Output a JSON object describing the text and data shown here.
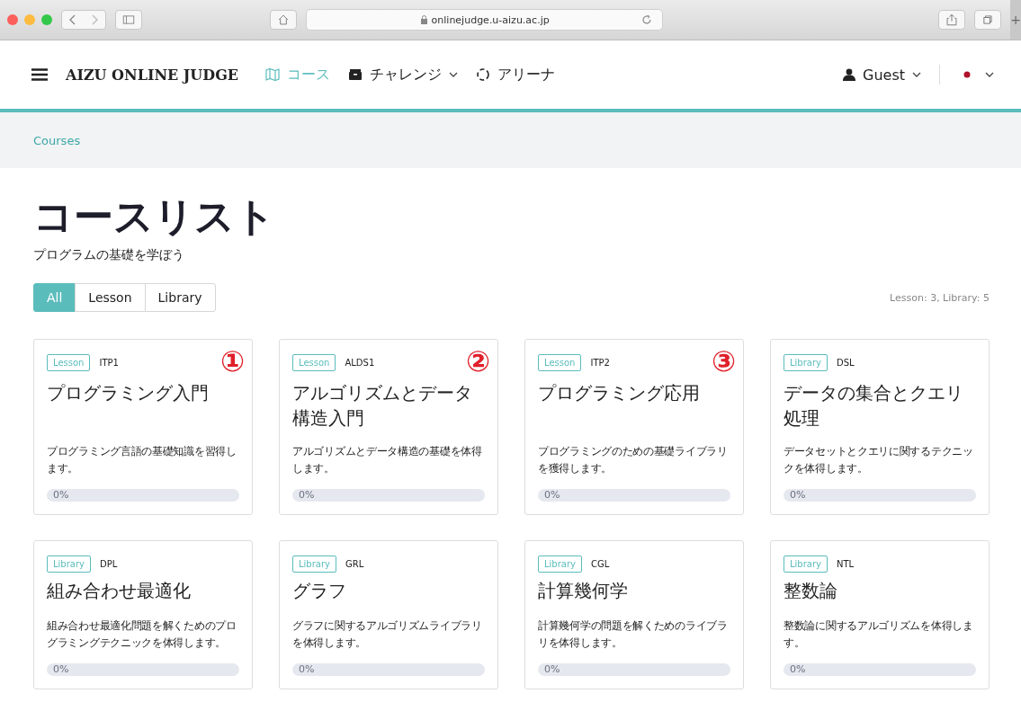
{
  "browser": {
    "url": "onlinejudge.u-aizu.ac.jp",
    "new_tab": "+"
  },
  "nav": {
    "brand": "AIZU ONLINE JUDGE",
    "items": [
      {
        "label": "コース",
        "selected": true,
        "dropdown": false
      },
      {
        "label": "チャレンジ",
        "selected": false,
        "dropdown": true
      },
      {
        "label": "アリーナ",
        "selected": false,
        "dropdown": false
      }
    ],
    "user": "Guest"
  },
  "breadcrumb": "Courses",
  "heading": "コースリスト",
  "subheading": "プログラムの基礎を学ぼう",
  "filters": [
    {
      "label": "All",
      "selected": true
    },
    {
      "label": "Lesson",
      "selected": false
    },
    {
      "label": "Library",
      "selected": false
    }
  ],
  "summary": "Lesson: 3, Library: 5",
  "courses": [
    {
      "tag": "Lesson",
      "code": "ITP1",
      "title": "プログラミング入門",
      "description": "プログラミング言語の基礎知識を習得します。",
      "progress": "0%",
      "level": 0,
      "annotation": "①"
    },
    {
      "tag": "Lesson",
      "code": "ALDS1",
      "title": "アルゴリズムとデータ構造入門",
      "description": "アルゴリズムとデータ構造の基礎を体得します。",
      "progress": "0%",
      "level": 0,
      "annotation": "②"
    },
    {
      "tag": "Lesson",
      "code": "ITP2",
      "title": "プログラミング応用",
      "description": "プログラミングのための基礎ライブラリを獲得します。",
      "progress": "0%",
      "level": 0,
      "annotation": "③"
    },
    {
      "tag": "Library",
      "code": "DSL",
      "title": "データの集合とクエリ処理",
      "description": "データセットとクエリに関するテクニックを体得します。",
      "progress": "0%",
      "level": 0
    },
    {
      "tag": "Library",
      "code": "DPL",
      "title": "組み合わせ最適化",
      "description": "組み合わせ最適化問題を解くためのプログラミングテクニックを体得します。",
      "progress": "0%",
      "level": 0
    },
    {
      "tag": "Library",
      "code": "GRL",
      "title": "グラフ",
      "description": "グラフに関するアルゴリズムライブラリを体得します。",
      "progress": "0%",
      "level": 0
    },
    {
      "tag": "Library",
      "code": "CGL",
      "title": "計算幾何学",
      "description": "計算幾何学の問題を解くためのライブラリを体得します。",
      "progress": "0%",
      "level": 0
    },
    {
      "tag": "Library",
      "code": "NTL",
      "title": "整数論",
      "description": "整数論に関するアルゴリズムを体得します。",
      "progress": "0%",
      "level": 0
    }
  ]
}
